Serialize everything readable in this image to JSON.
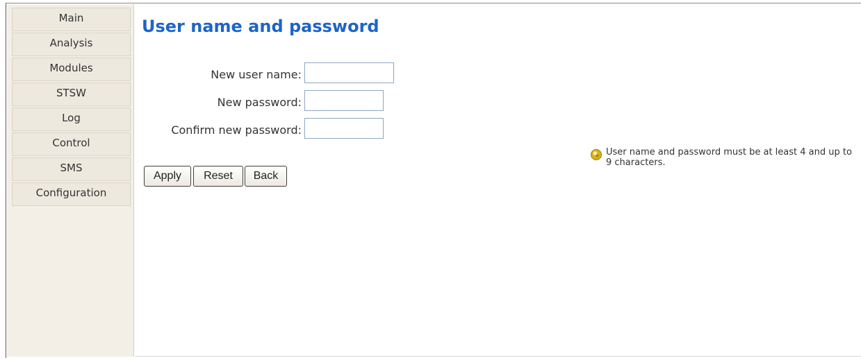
{
  "sidebar": {
    "items": [
      {
        "label": "Main"
      },
      {
        "label": "Analysis"
      },
      {
        "label": "Modules"
      },
      {
        "label": "STSW"
      },
      {
        "label": "Log"
      },
      {
        "label": "Control"
      },
      {
        "label": "SMS"
      },
      {
        "label": "Configuration"
      }
    ]
  },
  "main": {
    "title": "User name and password",
    "form": {
      "username_label": "New user name:",
      "username_value": "",
      "password_label": "New password:",
      "password_value": "",
      "confirm_label": "Confirm new password:",
      "confirm_value": ""
    },
    "buttons": {
      "apply": "Apply",
      "reset": "Reset",
      "back": "Back"
    },
    "hint": {
      "icon": "info-bulb-icon",
      "text": "User name and password must be at least 4 and up to 9 characters."
    }
  },
  "colors": {
    "title": "#1e64c8",
    "sidebar_bg": "#f3efe6"
  }
}
